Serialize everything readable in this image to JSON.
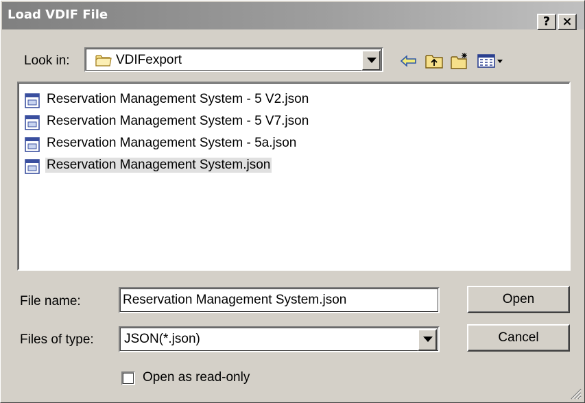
{
  "window": {
    "title": "Load VDIF File",
    "help_glyph": "?",
    "close_glyph": "×"
  },
  "look_in": {
    "label": "Look in:",
    "value": "VDIFexport",
    "icon": "folder-icon"
  },
  "toolbar": {
    "icons": [
      "back-arrow-icon",
      "up-folder-icon",
      "new-folder-icon",
      "view-menu-icon"
    ]
  },
  "files": [
    {
      "name": "Reservation Management System - 5  V2.json",
      "selected": false
    },
    {
      "name": "Reservation Management System - 5  V7.json",
      "selected": false
    },
    {
      "name": "Reservation Management System - 5a.json",
      "selected": false
    },
    {
      "name": "Reservation Management System.json",
      "selected": true
    }
  ],
  "file_name": {
    "label": "File name:",
    "value": "Reservation Management System.json"
  },
  "file_type": {
    "label": "Files of type:",
    "value": "JSON(*.json)"
  },
  "buttons": {
    "open": "Open",
    "cancel": "Cancel"
  },
  "readonly": {
    "label": "Open as read-only",
    "checked": false
  },
  "colors": {
    "dialog_face": "#d4d0c8",
    "title_gradient_start": "#808080",
    "selection_highlight": "#e0e0e0"
  }
}
